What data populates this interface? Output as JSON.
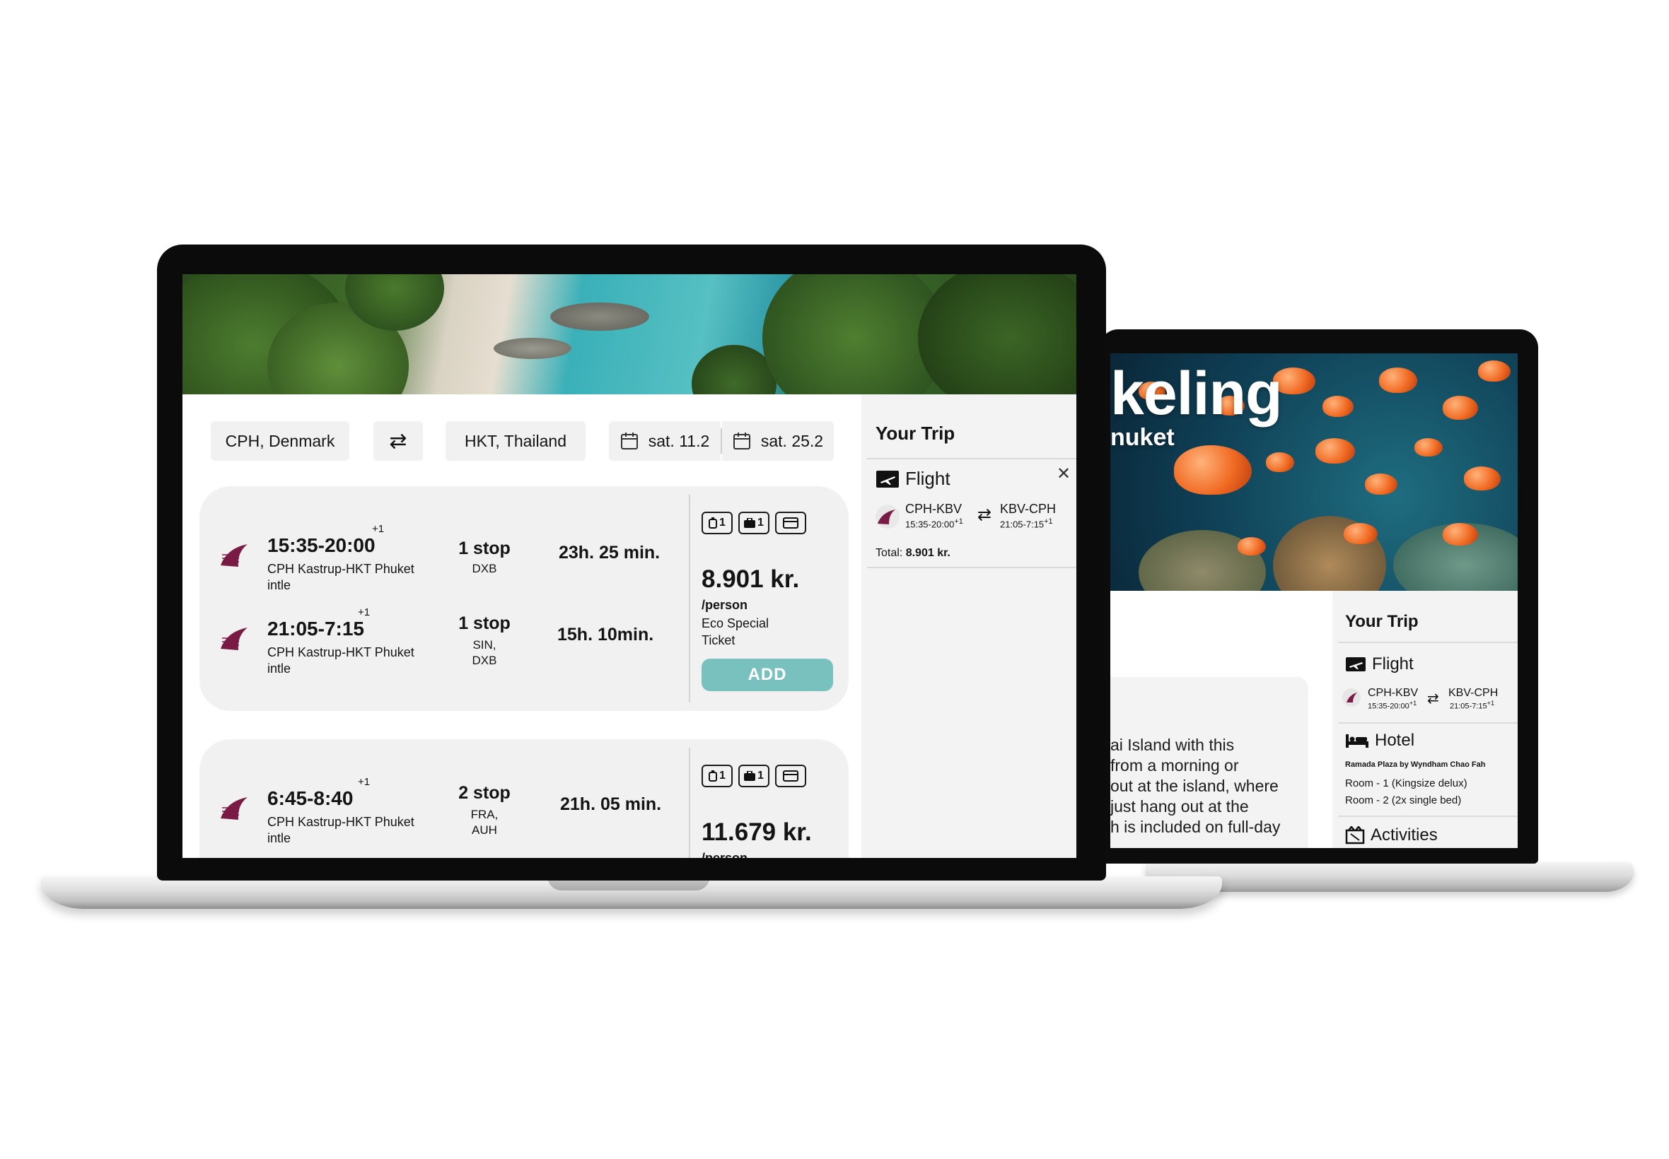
{
  "front": {
    "search": {
      "origin": "CPH, Denmark",
      "swap_icon": "swap-arrows-icon",
      "destination": "HKT, Thailand",
      "depart_date": "sat. 11.2",
      "return_date": "sat. 25.2"
    },
    "flights": [
      {
        "legs": [
          {
            "time": "15:35-20:00",
            "day_offset": "+1",
            "route": "CPH Kastrup-HKT Phuket intle",
            "stops": "1 stop",
            "stop_codes": "DXB",
            "duration": "23h. 25 min."
          },
          {
            "time": "21:05-7:15",
            "day_offset": "+1",
            "route": "CPH Kastrup-HKT Phuket intle",
            "stops": "1 stop",
            "stop_codes": "SIN, DXB",
            "duration": "15h. 10min."
          }
        ],
        "bags": {
          "carry_on": "1",
          "checked": "1"
        },
        "price": "8.901 kr.",
        "per_person": "/person",
        "ticket": "Eco Special Ticket",
        "add_label": "ADD"
      },
      {
        "legs": [
          {
            "time": "6:45-8:40",
            "day_offset": "+1",
            "route": "CPH Kastrup-HKT Phuket intle",
            "stops": "2 stop",
            "stop_codes": "FRA, AUH",
            "duration": "21h. 05 min."
          }
        ],
        "bags": {
          "carry_on": "1",
          "checked": "1"
        },
        "price": "11.679 kr.",
        "per_person": "/person"
      }
    ],
    "sidebar": {
      "title": "Your Trip",
      "flight_label": "Flight",
      "close_icon": "close-icon",
      "outbound": {
        "route": "CPH-KBV",
        "time": "15:35-20:00",
        "offset": "+1"
      },
      "inbound": {
        "route": "KBV-CPH",
        "time": "21:05-7:15",
        "offset": "+1"
      },
      "total_label": "Total:",
      "total_value": "8.901 kr."
    }
  },
  "back": {
    "hero_title": "keling",
    "hero_subtitle": "nuket",
    "description": "ai Island with this from a morning or out at the island, where just hang out at the h is included on full-day",
    "description_lines": [
      "ai Island with this",
      "from a morning or",
      "out at the island, where",
      "just hang out at the",
      "h is included on full-day"
    ],
    "sidebar": {
      "title": "Your Trip",
      "flight_label": "Flight",
      "outbound": {
        "route": "CPH-KBV",
        "time": "15:35-20:00",
        "offset": "+1"
      },
      "inbound": {
        "route": "KBV-CPH",
        "time": "21:05-7:15",
        "offset": "+1"
      },
      "hotel_label": "Hotel",
      "hotel_name": "Ramada Plaza by Wyndham Chao Fah",
      "rooms": [
        "Room - 1 (Kingsize delux)",
        "Room - 2 (2x single bed)"
      ],
      "activities_label": "Activities"
    }
  },
  "colors": {
    "accent": "#79c1bf",
    "card_bg": "#f1f1f1",
    "airline_maroon": "#7a1b45"
  }
}
